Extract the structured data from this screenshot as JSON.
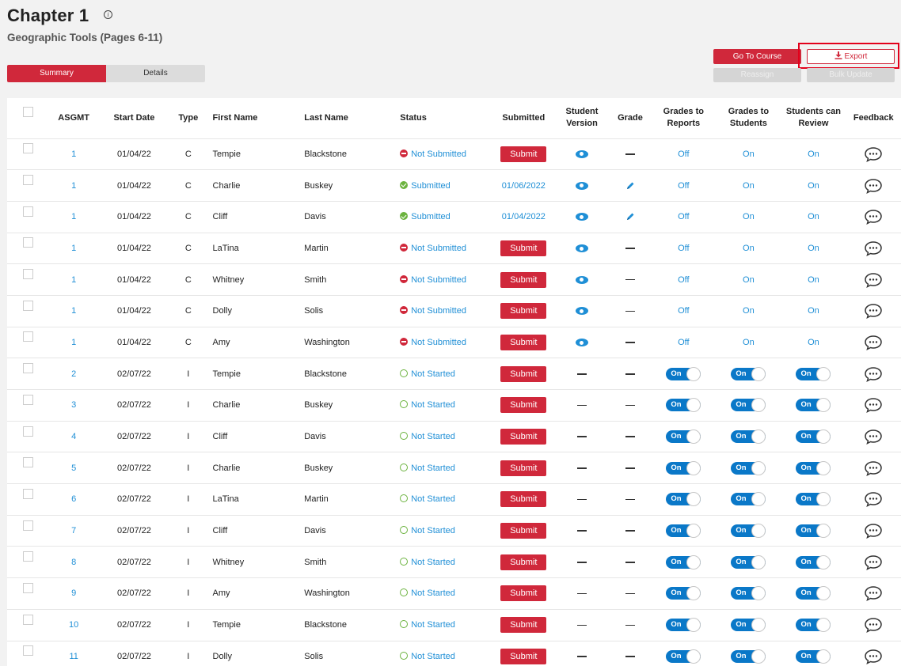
{
  "header": {
    "title": "Chapter 1",
    "info_icon": "info-icon",
    "subtitle": "Geographic Tools (Pages 6-11)"
  },
  "tabs": [
    {
      "label": "Summary",
      "active": true
    },
    {
      "label": "Details",
      "active": false
    }
  ],
  "actions": {
    "go_to_course": "Go To Course",
    "export": "Export",
    "reassign": "Reassign",
    "bulk_update": "Bulk Update"
  },
  "colors": {
    "accent_red": "#d0283b",
    "link_blue": "#1f8fd6",
    "toggle_blue": "#0a78c8",
    "success_green": "#6cb33f",
    "highlight_red": "#e3001b"
  },
  "table": {
    "headers": {
      "asgmt": "ASGMT",
      "start_date": "Start Date",
      "type": "Type",
      "first_name": "First Name",
      "last_name": "Last Name",
      "status": "Status",
      "submitted": "Submitted",
      "student_version": "Student Version",
      "grade": "Grade",
      "grades_to_reports": "Grades to Reports",
      "grades_to_students": "Grades to Students",
      "students_can_review": "Students can Review",
      "feedback": "Feedback"
    },
    "rows": [
      {
        "asgmt": "1",
        "start": "01/04/22",
        "type": "C",
        "first": "Tempie",
        "last": "Blackstone",
        "status": "Not Submitted",
        "status_kind": "not-submitted",
        "submitted": "Submit",
        "submitted_kind": "button",
        "version": "eye",
        "grade": "dash",
        "reports": "Off",
        "students": "On",
        "review": "On",
        "ctrl": "text"
      },
      {
        "asgmt": "1",
        "start": "01/04/22",
        "type": "C",
        "first": "Charlie",
        "last": "Buskey",
        "status": "Submitted",
        "status_kind": "submitted",
        "submitted": "01/06/2022",
        "submitted_kind": "date",
        "version": "eye",
        "grade": "pencil",
        "reports": "Off",
        "students": "On",
        "review": "On",
        "ctrl": "text"
      },
      {
        "asgmt": "1",
        "start": "01/04/22",
        "type": "C",
        "first": "Cliff",
        "last": "Davis",
        "status": "Submitted",
        "status_kind": "submitted",
        "submitted": "01/04/2022",
        "submitted_kind": "date",
        "version": "eye",
        "grade": "pencil",
        "reports": "Off",
        "students": "On",
        "review": "On",
        "ctrl": "text"
      },
      {
        "asgmt": "1",
        "start": "01/04/22",
        "type": "C",
        "first": "LaTina",
        "last": "Martin",
        "status": "Not Submitted",
        "status_kind": "not-submitted",
        "submitted": "Submit",
        "submitted_kind": "button",
        "version": "eye",
        "grade": "dash",
        "reports": "Off",
        "students": "On",
        "review": "On",
        "ctrl": "text"
      },
      {
        "asgmt": "1",
        "start": "01/04/22",
        "type": "C",
        "first": "Whitney",
        "last": "Smith",
        "status": "Not Submitted",
        "status_kind": "not-submitted",
        "submitted": "Submit",
        "submitted_kind": "button",
        "version": "eye",
        "grade": "dash",
        "reports": "Off",
        "students": "On",
        "review": "On",
        "ctrl": "text"
      },
      {
        "asgmt": "1",
        "start": "01/04/22",
        "type": "C",
        "first": "Dolly",
        "last": "Solis",
        "status": "Not Submitted",
        "status_kind": "not-submitted",
        "submitted": "Submit",
        "submitted_kind": "button",
        "version": "eye",
        "grade": "dash",
        "reports": "Off",
        "students": "On",
        "review": "On",
        "ctrl": "text"
      },
      {
        "asgmt": "1",
        "start": "01/04/22",
        "type": "C",
        "first": "Amy",
        "last": "Washington",
        "status": "Not Submitted",
        "status_kind": "not-submitted",
        "submitted": "Submit",
        "submitted_kind": "button",
        "version": "eye",
        "grade": "dash",
        "reports": "Off",
        "students": "On",
        "review": "On",
        "ctrl": "text"
      },
      {
        "asgmt": "2",
        "start": "02/07/22",
        "type": "I",
        "first": "Tempie",
        "last": "Blackstone",
        "status": "Not Started",
        "status_kind": "not-started",
        "submitted": "Submit",
        "submitted_kind": "button",
        "version": "dash",
        "grade": "dash",
        "reports": "On",
        "students": "On",
        "review": "On",
        "ctrl": "toggle"
      },
      {
        "asgmt": "3",
        "start": "02/07/22",
        "type": "I",
        "first": "Charlie",
        "last": "Buskey",
        "status": "Not Started",
        "status_kind": "not-started",
        "submitted": "Submit",
        "submitted_kind": "button",
        "version": "dash",
        "grade": "dash",
        "reports": "On",
        "students": "On",
        "review": "On",
        "ctrl": "toggle"
      },
      {
        "asgmt": "4",
        "start": "02/07/22",
        "type": "I",
        "first": "Cliff",
        "last": "Davis",
        "status": "Not Started",
        "status_kind": "not-started",
        "submitted": "Submit",
        "submitted_kind": "button",
        "version": "dash",
        "grade": "dash",
        "reports": "On",
        "students": "On",
        "review": "On",
        "ctrl": "toggle"
      },
      {
        "asgmt": "5",
        "start": "02/07/22",
        "type": "I",
        "first": "Charlie",
        "last": "Buskey",
        "status": "Not Started",
        "status_kind": "not-started",
        "submitted": "Submit",
        "submitted_kind": "button",
        "version": "dash",
        "grade": "dash",
        "reports": "On",
        "students": "On",
        "review": "On",
        "ctrl": "toggle"
      },
      {
        "asgmt": "6",
        "start": "02/07/22",
        "type": "I",
        "first": "LaTina",
        "last": "Martin",
        "status": "Not Started",
        "status_kind": "not-started",
        "submitted": "Submit",
        "submitted_kind": "button",
        "version": "dash",
        "grade": "dash",
        "reports": "On",
        "students": "On",
        "review": "On",
        "ctrl": "toggle"
      },
      {
        "asgmt": "7",
        "start": "02/07/22",
        "type": "I",
        "first": "Cliff",
        "last": "Davis",
        "status": "Not Started",
        "status_kind": "not-started",
        "submitted": "Submit",
        "submitted_kind": "button",
        "version": "dash",
        "grade": "dash",
        "reports": "On",
        "students": "On",
        "review": "On",
        "ctrl": "toggle"
      },
      {
        "asgmt": "8",
        "start": "02/07/22",
        "type": "I",
        "first": "Whitney",
        "last": "Smith",
        "status": "Not Started",
        "status_kind": "not-started",
        "submitted": "Submit",
        "submitted_kind": "button",
        "version": "dash",
        "grade": "dash",
        "reports": "On",
        "students": "On",
        "review": "On",
        "ctrl": "toggle"
      },
      {
        "asgmt": "9",
        "start": "02/07/22",
        "type": "I",
        "first": "Amy",
        "last": "Washington",
        "status": "Not Started",
        "status_kind": "not-started",
        "submitted": "Submit",
        "submitted_kind": "button",
        "version": "dash",
        "grade": "dash",
        "reports": "On",
        "students": "On",
        "review": "On",
        "ctrl": "toggle"
      },
      {
        "asgmt": "10",
        "start": "02/07/22",
        "type": "I",
        "first": "Tempie",
        "last": "Blackstone",
        "status": "Not Started",
        "status_kind": "not-started",
        "submitted": "Submit",
        "submitted_kind": "button",
        "version": "dash",
        "grade": "dash",
        "reports": "On",
        "students": "On",
        "review": "On",
        "ctrl": "toggle"
      },
      {
        "asgmt": "11",
        "start": "02/07/22",
        "type": "I",
        "first": "Dolly",
        "last": "Solis",
        "status": "Not Started",
        "status_kind": "not-started",
        "submitted": "Submit",
        "submitted_kind": "button",
        "version": "dash",
        "grade": "dash",
        "reports": "On",
        "students": "On",
        "review": "On",
        "ctrl": "toggle"
      }
    ]
  }
}
